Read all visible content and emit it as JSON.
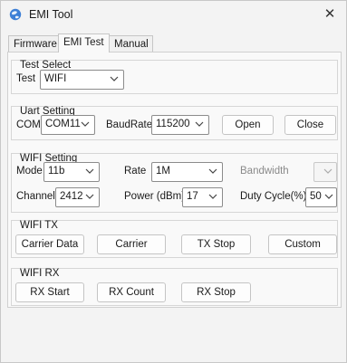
{
  "window": {
    "title": "EMI Tool",
    "close_glyph": "✕",
    "icon": "app-globe-icon"
  },
  "tabs": [
    {
      "label": "Firmware",
      "active": false
    },
    {
      "label": "EMI Test",
      "active": true
    },
    {
      "label": "Manual",
      "active": false
    }
  ],
  "test_select": {
    "title": "Test Select",
    "test_label": "Test",
    "test_value": "WIFI"
  },
  "uart": {
    "title": "Uart Setting",
    "com_label": "COM",
    "com_value": "COM11",
    "baud_label": "BaudRate",
    "baud_value": "115200",
    "open_label": "Open",
    "close_label": "Close"
  },
  "wifi_setting": {
    "title": "WIFI Setting",
    "mode_label": "Mode",
    "mode_value": "11b",
    "rate_label": "Rate",
    "rate_value": "1M",
    "bandwidth_label": "Bandwidth",
    "bandwidth_value": "",
    "channel_label": "Channel",
    "channel_value": "2412",
    "power_label": "Power (dBm)",
    "power_value": "17",
    "duty_label": "Duty Cycle(%)",
    "duty_value": "50"
  },
  "wifi_tx": {
    "title": "WIFI TX",
    "buttons": [
      "Carrier Data",
      "Carrier",
      "TX Stop",
      "Custom"
    ]
  },
  "wifi_rx": {
    "title": "WIFI RX",
    "buttons": [
      "RX Start",
      "RX Count",
      "RX Stop"
    ]
  }
}
